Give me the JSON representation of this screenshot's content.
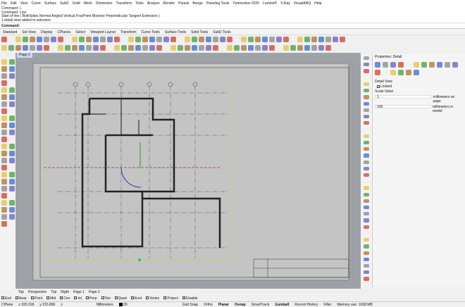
{
  "menu": [
    "File",
    "Edit",
    "View",
    "Curve",
    "Surface",
    "SubD",
    "Solid",
    "Mesh",
    "Dimension",
    "Transform",
    "Tools",
    "Analyze",
    "Render",
    "Panels",
    "Bongo",
    "Paneling Tools",
    "Twinmotion 2020",
    "Lumion®",
    "V-Ray",
    "VisualARQ",
    "Help"
  ],
  "history": [
    "Command: L",
    "Command: Line",
    "Start of line ( BothSides Normal Angled Vertical FourPoint Bisector Perpendicular Tangent Extension )",
    "1 detail view added to selection."
  ],
  "command_prompt": "Command:",
  "toolbar_tabs": [
    "Standard",
    "Set View",
    "Display",
    "CPlanes",
    "Select",
    "Viewport Layout",
    "Transform",
    "Curve Tools",
    "Surface Tools",
    "Solid Tools",
    "SubD Tools"
  ],
  "page_tab": "Page 2",
  "properties": {
    "title": "Properties: Detail",
    "section": "Detail View",
    "locked_label": "Locked",
    "locked": false,
    "scale_label": "Scale Value",
    "page_value": "1",
    "page_unit": "millimeters on page",
    "model_value": "100",
    "model_unit": "millimeters in model"
  },
  "viewport_tabs": [
    "Top",
    "Perspective",
    "Top",
    "Right",
    "Page 1",
    "Page 2"
  ],
  "osnaps": [
    {
      "label": "End",
      "on": true
    },
    {
      "label": "Near",
      "on": true
    },
    {
      "label": "Point",
      "on": true
    },
    {
      "label": "Mid",
      "on": true
    },
    {
      "label": "Cen",
      "on": false
    },
    {
      "label": "Int",
      "on": true
    },
    {
      "label": "Perp",
      "on": true
    },
    {
      "label": "Tan",
      "on": true
    },
    {
      "label": "Quad",
      "on": true
    },
    {
      "label": "Knot",
      "on": false
    },
    {
      "label": "Vertex",
      "on": true
    },
    {
      "label": "Project",
      "on": false
    },
    {
      "label": "Disable",
      "on": false
    }
  ],
  "status": {
    "cplane": "CPlane",
    "x": "x 326.318",
    "y": "y 215.806",
    "z": "z",
    "units": "Millimeters",
    "layer": "00",
    "grid_snap": "Grid Snap",
    "ortho": "Ortho",
    "planar": "Planar",
    "osnap": "Osnap",
    "smarttrack": "SmartTrack",
    "gumball": "Gumball",
    "record_history": "Record History",
    "filter": "Filter",
    "memory": "Memory use: 1038 MB"
  },
  "colors": {
    "viewport": "#9ea2a7",
    "paper": "#c4c4c4",
    "detail_border": "#d8d040",
    "accent": "#2b5fb8"
  }
}
